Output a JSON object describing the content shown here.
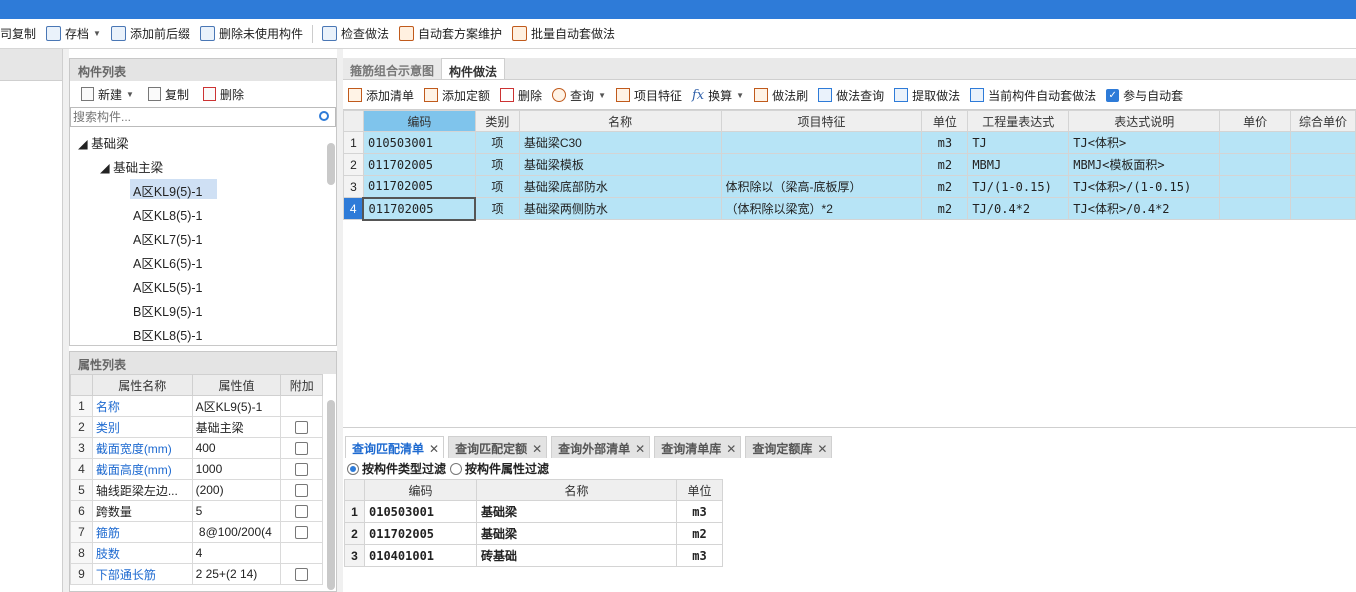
{
  "toolbar": {
    "items": [
      {
        "label": "司复制",
        "icon": "copy-icon"
      },
      {
        "label": "存档",
        "icon": "archive-icon",
        "dropdown": true
      },
      {
        "label": "添加前后缀",
        "icon": "prefix-suffix-icon"
      },
      {
        "label": "删除未使用构件",
        "icon": "delete-unused-icon"
      },
      {
        "label": "检查做法",
        "icon": "check-method-icon"
      },
      {
        "label": "自动套方案维护",
        "icon": "auto-scheme-icon"
      },
      {
        "label": "批量自动套做法",
        "icon": "batch-auto-icon"
      }
    ]
  },
  "component_list": {
    "title": "构件列表",
    "actions": {
      "new": "新建",
      "copy": "复制",
      "delete": "删除"
    },
    "search_placeholder": "搜索构件...",
    "tree": {
      "root": "基础梁",
      "child": "基础主梁",
      "items": [
        "A区KL9(5)-1",
        "A区KL8(5)-1",
        "A区KL7(5)-1",
        "A区KL6(5)-1",
        "A区KL5(5)-1",
        "B区KL9(5)-1",
        "B区KL8(5)-1"
      ],
      "selected": "A区KL9(5)-1"
    }
  },
  "property_list": {
    "title": "属性列表",
    "headers": [
      "属性名称",
      "属性值",
      "附加"
    ],
    "rows": [
      {
        "idx": "1",
        "name": "名称",
        "value": "A区KL9(5)-1",
        "blue": true,
        "check": false
      },
      {
        "idx": "2",
        "name": "类别",
        "value": "基础主梁",
        "blue": true,
        "check": true
      },
      {
        "idx": "3",
        "name": "截面宽度(mm)",
        "value": "400",
        "blue": true,
        "check": true
      },
      {
        "idx": "4",
        "name": "截面高度(mm)",
        "value": "1000",
        "blue": true,
        "check": true
      },
      {
        "idx": "5",
        "name": "轴线距梁左边...",
        "value": "(200)",
        "blue": false,
        "check": true
      },
      {
        "idx": "6",
        "name": "跨数量",
        "value": "5",
        "blue": false,
        "check": true
      },
      {
        "idx": "7",
        "name": "箍筋",
        "value": " 8@100/200(4",
        "blue": true,
        "check": true
      },
      {
        "idx": "8",
        "name": "肢数",
        "value": "4",
        "blue": true,
        "check": false
      },
      {
        "idx": "9",
        "name": "下部通长筋",
        "value": "2 25+(2 14)",
        "blue": true,
        "check": true
      }
    ]
  },
  "main_tabs": {
    "tab1": "箍筋组合示意图",
    "tab2": "构件做法"
  },
  "method_toolbar": {
    "add_list": "添加清单",
    "add_quota": "添加定额",
    "delete": "删除",
    "query": "查询",
    "project_feature": "项目特征",
    "convert": "换算",
    "method_brush": "做法刷",
    "method_query": "做法查询",
    "extract_method": "提取做法",
    "auto_current": "当前构件自动套做法",
    "participate_auto": "参与自动套"
  },
  "main_grid": {
    "headers": [
      "编码",
      "类别",
      "名称",
      "项目特征",
      "单位",
      "工程量表达式",
      "表达式说明",
      "单价",
      "综合单价"
    ],
    "rows": [
      {
        "idx": "1",
        "code": "010503001",
        "type": "项",
        "name": "基础梁C30",
        "feature": "",
        "unit": "m3",
        "expr": "TJ",
        "desc": "TJ<体积>"
      },
      {
        "idx": "2",
        "code": "011702005",
        "type": "项",
        "name": "基础梁模板",
        "feature": "",
        "unit": "m2",
        "expr": "MBMJ",
        "desc": "MBMJ<模板面积>"
      },
      {
        "idx": "3",
        "code": "011702005",
        "type": "项",
        "name": "基础梁底部防水",
        "feature": "体积除以（梁高-底板厚）",
        "unit": "m2",
        "expr": "TJ/(1-0.15)",
        "desc": "TJ<体积>/(1-0.15)"
      },
      {
        "idx": "4",
        "code": "011702005",
        "type": "项",
        "name": "基础梁两侧防水",
        "feature": "（体积除以梁宽）*2",
        "unit": "m2",
        "expr": "TJ/0.4*2",
        "desc": "TJ<体积>/0.4*2"
      }
    ]
  },
  "bottom_tabs": [
    "查询匹配清单",
    "查询匹配定额",
    "查询外部清单",
    "查询清单库",
    "查询定额库"
  ],
  "filter": {
    "opt1": "按构件类型过滤",
    "opt2": "按构件属性过滤"
  },
  "query_grid": {
    "headers": [
      "编码",
      "名称",
      "单位"
    ],
    "rows": [
      {
        "idx": "1",
        "code": "010503001",
        "name": "基础梁",
        "unit": "m3"
      },
      {
        "idx": "2",
        "code": "011702005",
        "name": "基础梁",
        "unit": "m2"
      },
      {
        "idx": "3",
        "code": "010401001",
        "name": "砖基础",
        "unit": "m3"
      }
    ]
  }
}
